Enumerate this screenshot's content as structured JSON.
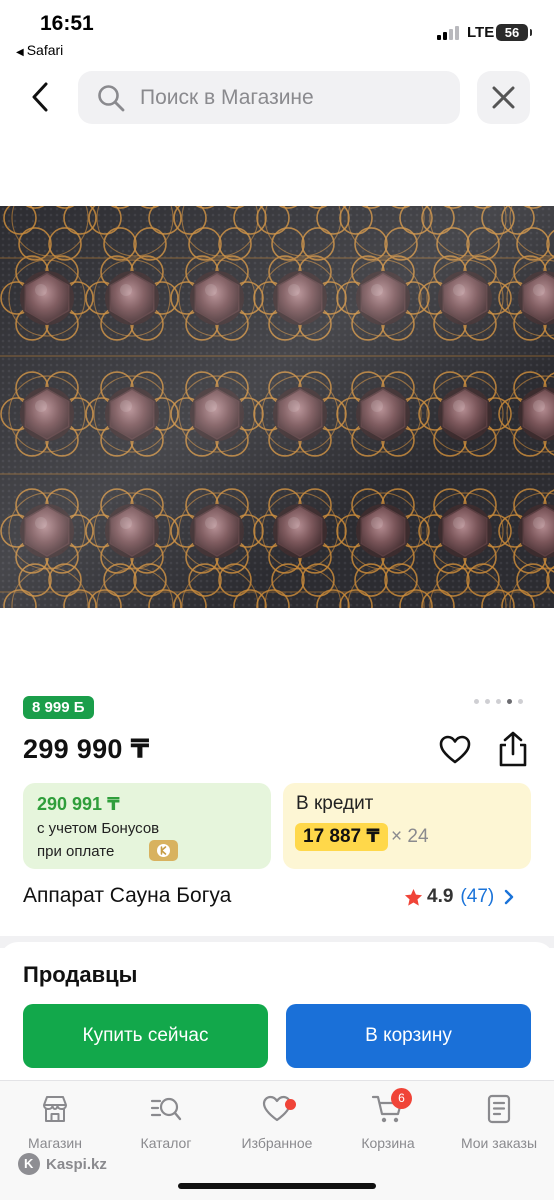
{
  "status_bar": {
    "time": "16:51",
    "back_app": "Safari",
    "network": "LTE",
    "battery": "56"
  },
  "search": {
    "placeholder": "Поиск в Магазине"
  },
  "product": {
    "bonus_badge": "8 999 Б",
    "price": "299 990 ₸",
    "title": "Аппарат Сауна Богуа",
    "rating": "4.9",
    "reviews": "(47)",
    "image_pages": 5,
    "image_page_active": 4
  },
  "bonus_offer": {
    "price": "290 991 ₸",
    "line1": "с учетом Бонусов",
    "line2": "при оплате"
  },
  "credit_offer": {
    "title": "В кредит",
    "monthly": "17 887 ₸",
    "months": "× 24"
  },
  "sellers": {
    "title": "Продавцы",
    "buy_now": "Купить сейчас",
    "add_to_cart": "В корзину"
  },
  "tabs": [
    {
      "label": "Магазин",
      "icon": "store-icon"
    },
    {
      "label": "Каталог",
      "icon": "catalog-icon"
    },
    {
      "label": "Избранное",
      "icon": "heart-icon"
    },
    {
      "label": "Корзина",
      "icon": "cart-icon",
      "badge": "6"
    },
    {
      "label": "Мои заказы",
      "icon": "orders-icon"
    }
  ],
  "site": "Kaspi.kz",
  "colors": {
    "accent_green": "#12a84b",
    "accent_blue": "#1a70d8",
    "credit_yellow": "#ffd84a",
    "badge_red": "#f04438"
  }
}
